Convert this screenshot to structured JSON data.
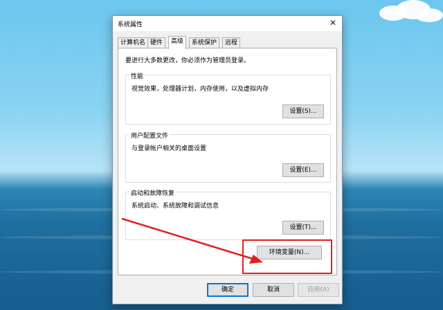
{
  "window": {
    "title": "系统属性"
  },
  "tabs": [
    "计算机名",
    "硬件",
    "高级",
    "系统保护",
    "远程"
  ],
  "notice": "要进行大多数更改，你必须作为管理员登录。",
  "performance": {
    "title": "性能",
    "description": "视觉效果，处理器计划，内存使用，以及虚拟内存",
    "button": "设置(S)..."
  },
  "user_profiles": {
    "title": "用户配置文件",
    "description": "与登录帐户相关的桌面设置",
    "button": "设置(E)..."
  },
  "startup_recovery": {
    "title": "启动和故障恢复",
    "description": "系统启动、系统故障和调试信息",
    "button": "设置(T)..."
  },
  "env_button": "环境变量(N)...",
  "footer": {
    "ok": "确定",
    "cancel": "取消",
    "apply": "应用(A)"
  },
  "accent_colors": {
    "annotation_red": "#e02020",
    "focus_blue": "#0078d7"
  }
}
